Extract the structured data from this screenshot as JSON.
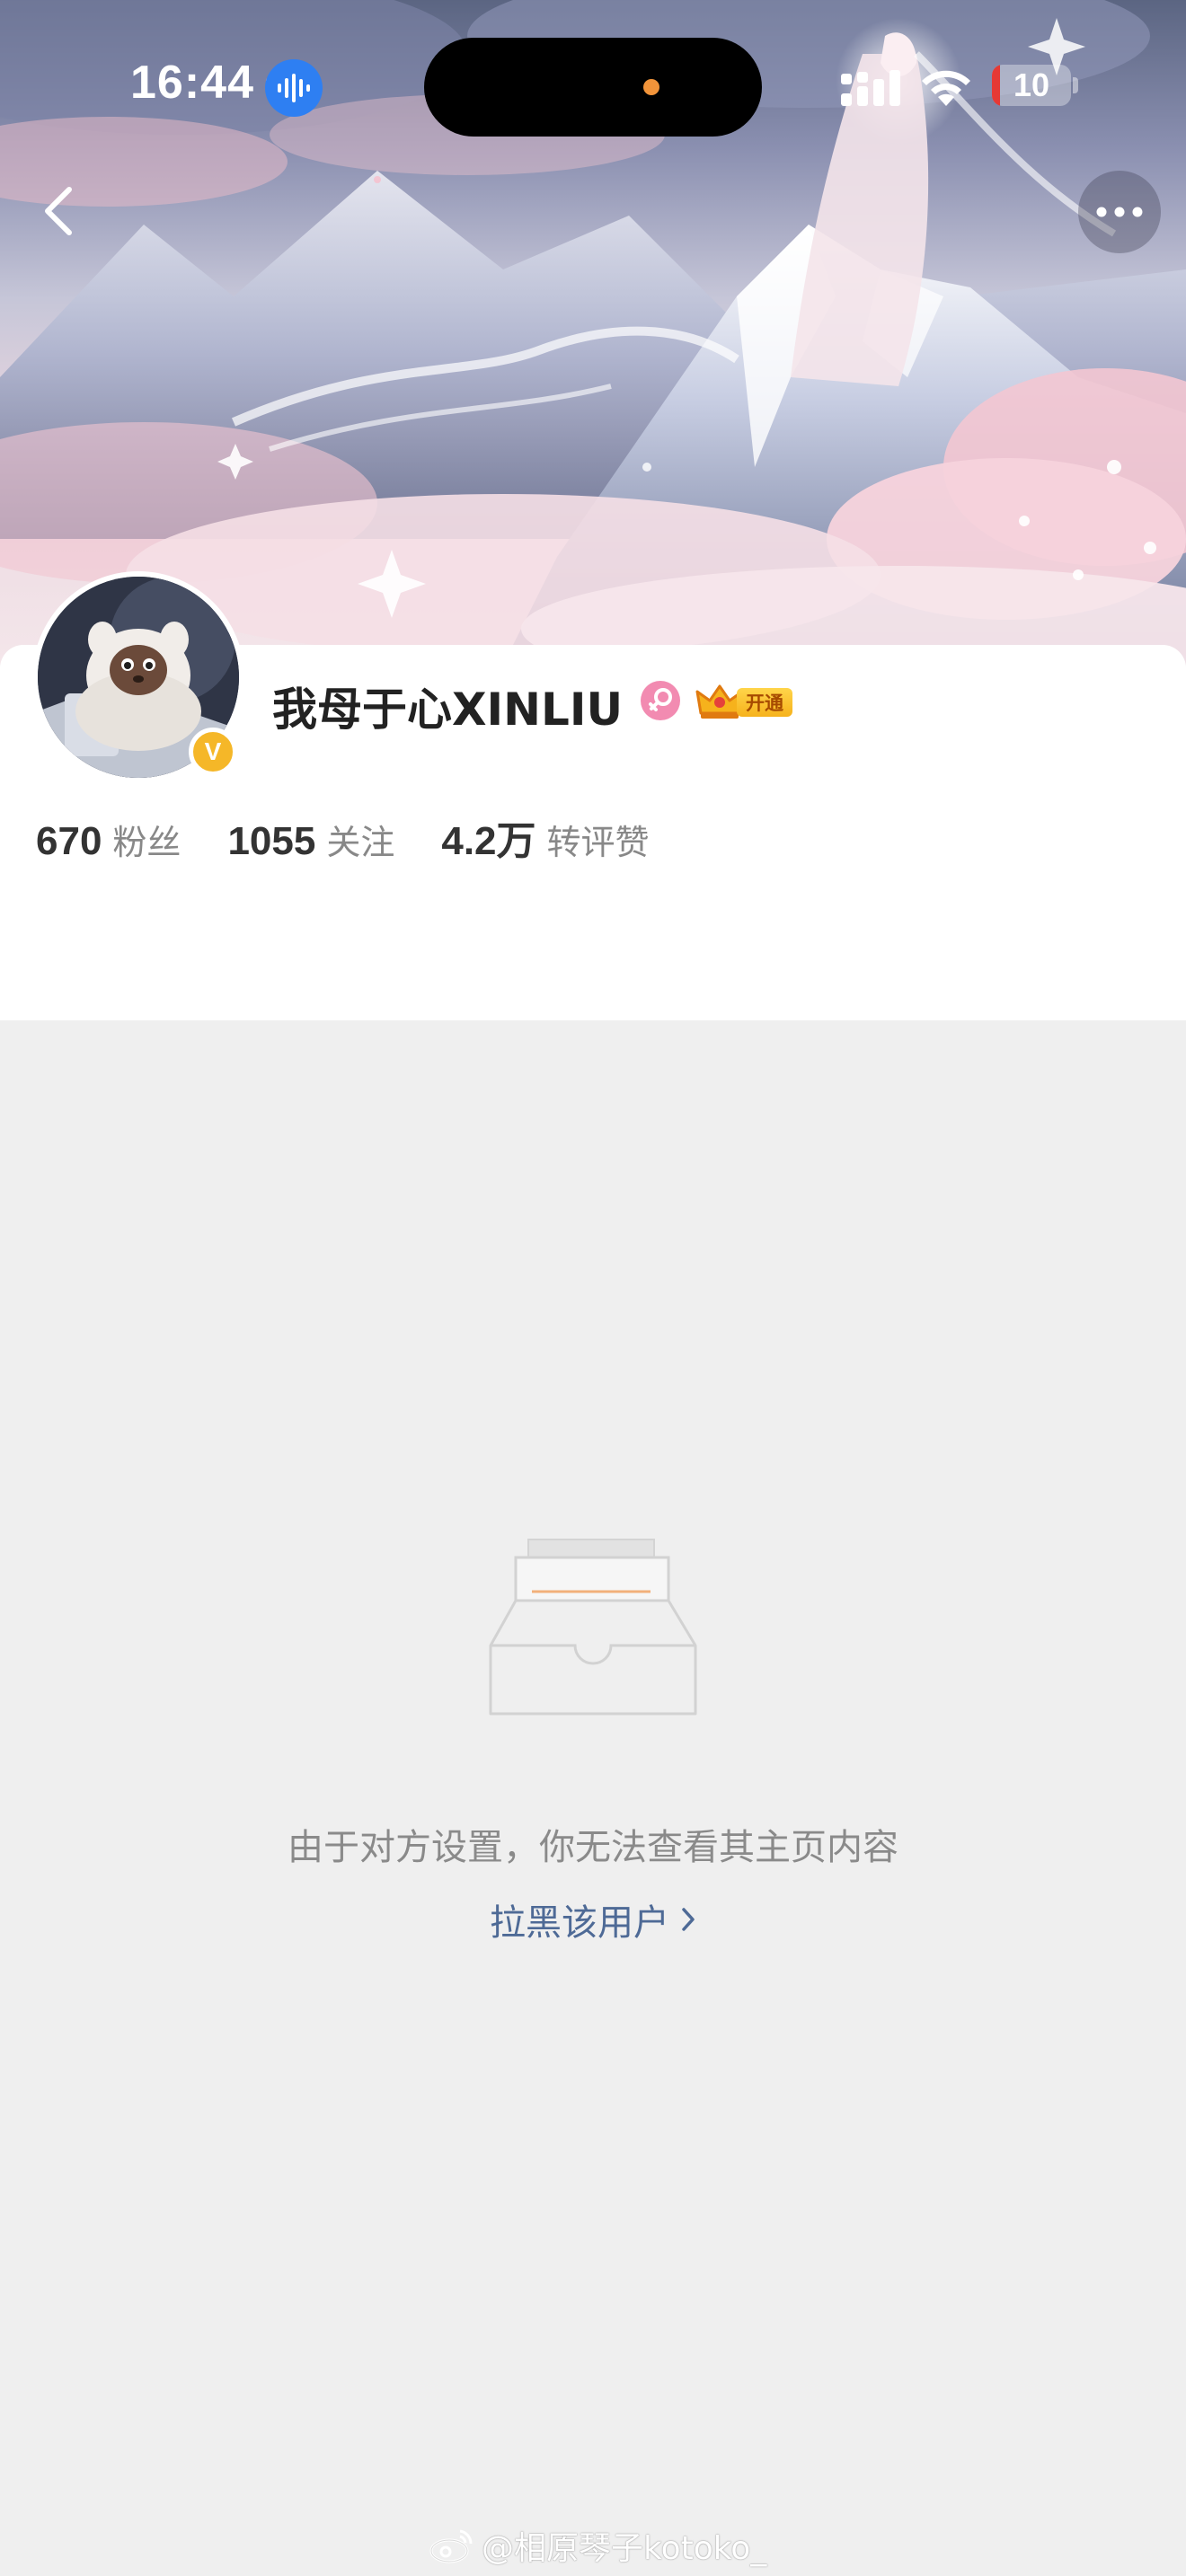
{
  "status_bar": {
    "time": "16:44",
    "battery_level": "10",
    "battery_fraction": 0.1,
    "battery_color": "#e53935"
  },
  "profile": {
    "username": "我母于心XINLIU",
    "gender": "female-icon",
    "vip_label": "开通",
    "verified_color": "#f5b728",
    "verified_mark": "V",
    "stats": [
      {
        "value": "670",
        "label": "粉丝"
      },
      {
        "value": "1055",
        "label": "关注"
      },
      {
        "value": "4.2万",
        "label": "转评赞"
      }
    ]
  },
  "empty_state": {
    "icon": "empty-inbox-icon",
    "message": "由于对方设置，你无法查看其主页内容",
    "block_link": "拉黑该用户",
    "link_color": "#4e6a96"
  },
  "watermark": {
    "text": "@相原琴子kotoko_"
  }
}
